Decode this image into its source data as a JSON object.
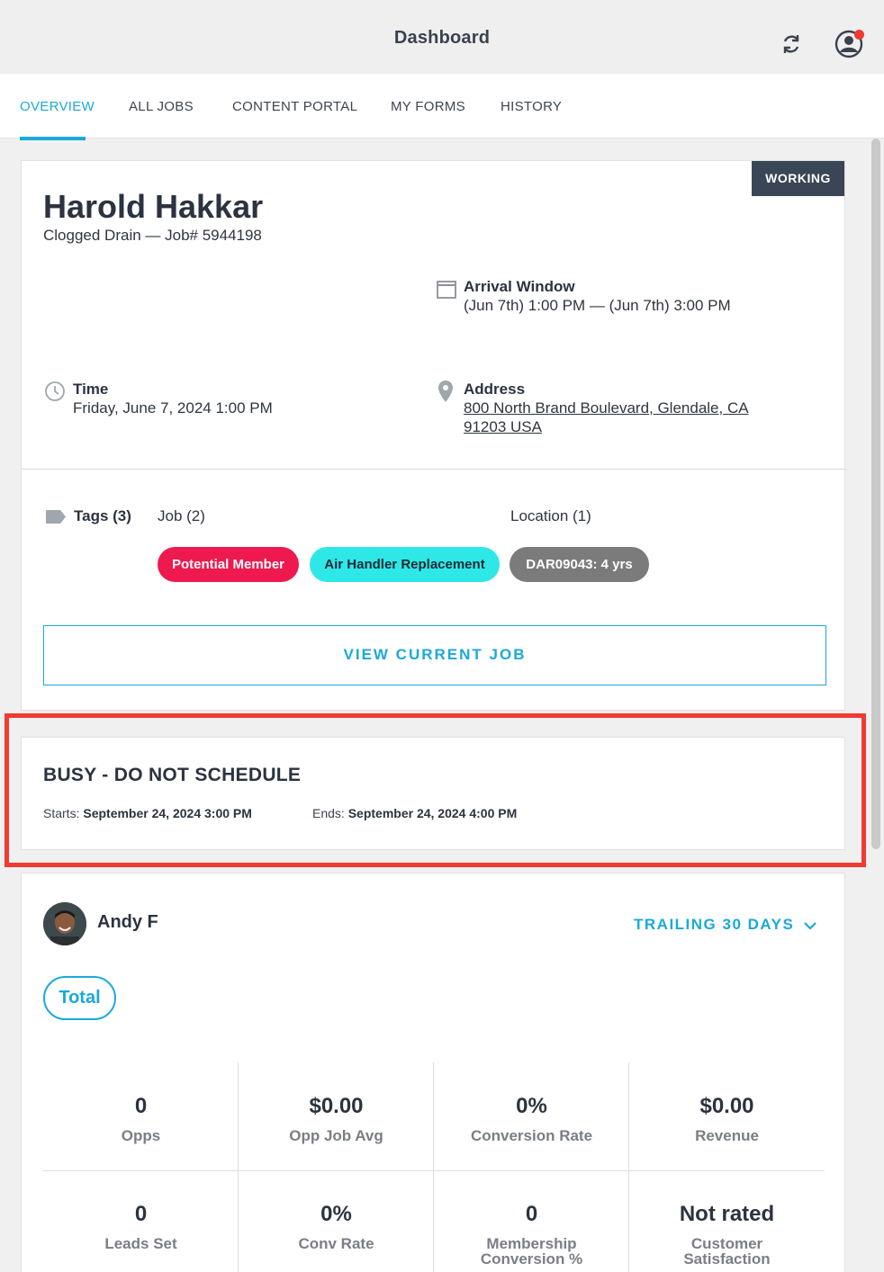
{
  "header": {
    "title": "Dashboard",
    "sync_icon": "refresh-icon",
    "profile_icon": "user-circle-icon",
    "notification_color": "#ef3b32"
  },
  "tabs": [
    {
      "label": "OVERVIEW",
      "active": true
    },
    {
      "label": "ALL JOBS",
      "active": false
    },
    {
      "label": "CONTENT PORTAL",
      "active": false
    },
    {
      "label": "MY FORMS",
      "active": false
    },
    {
      "label": "HISTORY",
      "active": false
    }
  ],
  "job": {
    "status": "WORKING",
    "customer": "Harold Hakkar",
    "subtitle": "Clogged Drain — Job# 5944198",
    "arrival_label": "Arrival Window",
    "arrival_value": "(Jun 7th) 1:00 PM — (Jun 7th) 3:00 PM",
    "time_label": "Time",
    "time_value": "Friday, June 7, 2024 1:00 PM",
    "address_label": "Address",
    "address_value": "800 North Brand Boulevard, Glendale, CA 91203 USA",
    "tags_label": "Tags (3)",
    "job_tags_label": "Job (2)",
    "location_tags_label": "Location (1)",
    "tags": [
      "Potential Member",
      "Air Handler Replacement",
      "DAR09043: 4 yrs"
    ],
    "view_button": "VIEW CURRENT JOB"
  },
  "busy": {
    "title": "BUSY - DO NOT SCHEDULE",
    "starts_label": "Starts:",
    "starts_value": "September 24, 2024 3:00 PM",
    "ends_label": "Ends:",
    "ends_value": "September 24, 2024 4:00 PM"
  },
  "stats": {
    "tech_name": "Andy F",
    "period": "TRAILING 30 DAYS",
    "filter": "Total",
    "row1": [
      {
        "value": "0",
        "label": "Opps"
      },
      {
        "value": "$0.00",
        "label": "Opp Job Avg"
      },
      {
        "value": "0%",
        "label": "Conversion Rate"
      },
      {
        "value": "$0.00",
        "label": "Revenue"
      }
    ],
    "row2": [
      {
        "value": "0",
        "label": "Leads Set"
      },
      {
        "value": "0%",
        "label": "Conv Rate"
      },
      {
        "value": "0",
        "label": "Membership Conversion %"
      },
      {
        "value": "Not rated",
        "label": "Customer Satisfaction"
      }
    ]
  }
}
